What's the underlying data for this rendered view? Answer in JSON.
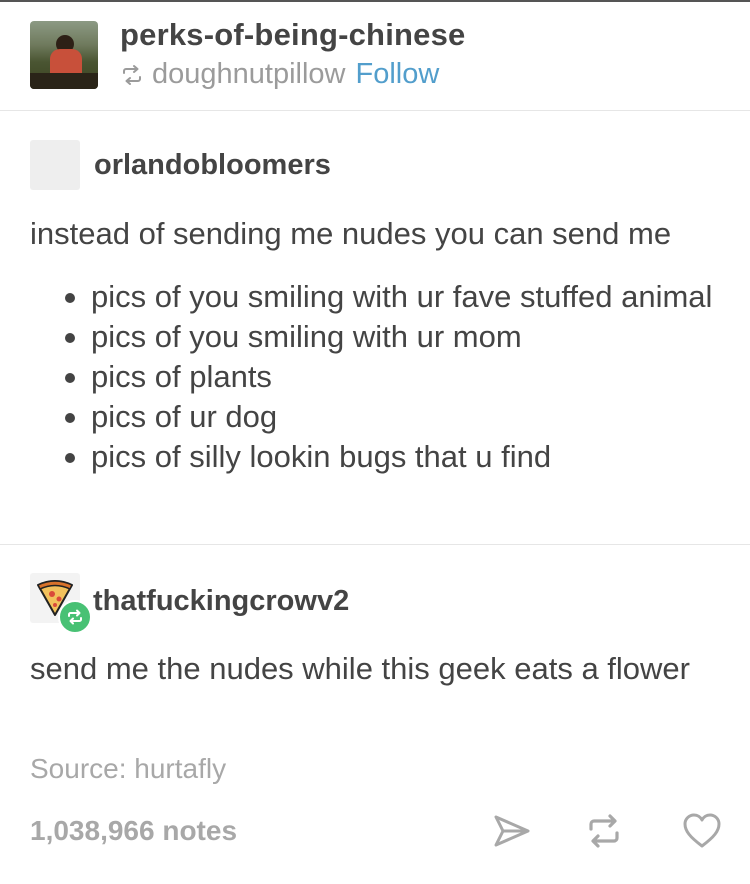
{
  "header": {
    "blog_name": "perks-of-being-chinese",
    "reblogged_from": "doughnutpillow",
    "follow_label": "Follow"
  },
  "post1": {
    "username": "orlandobloomers",
    "intro": "instead of sending me nudes you can send me",
    "bullets": [
      "pics of you smiling with ur fave stuffed animal",
      "pics of you smiling with ur mom",
      "pics of plants",
      "pics of ur dog",
      "pics of silly lookin bugs that u find"
    ]
  },
  "post2": {
    "username": "thatfuckingcrowv2",
    "text": "send me the nudes while this geek eats a flower"
  },
  "footer": {
    "source": "Source: hurtafly",
    "notes": "1,038,966 notes",
    "actions": [
      "share-icon",
      "reblog-icon",
      "heart-icon"
    ]
  },
  "colors": {
    "follow": "#529ecc",
    "reblog_badge": "#48c174",
    "muted_text": "#a8a8a8"
  }
}
